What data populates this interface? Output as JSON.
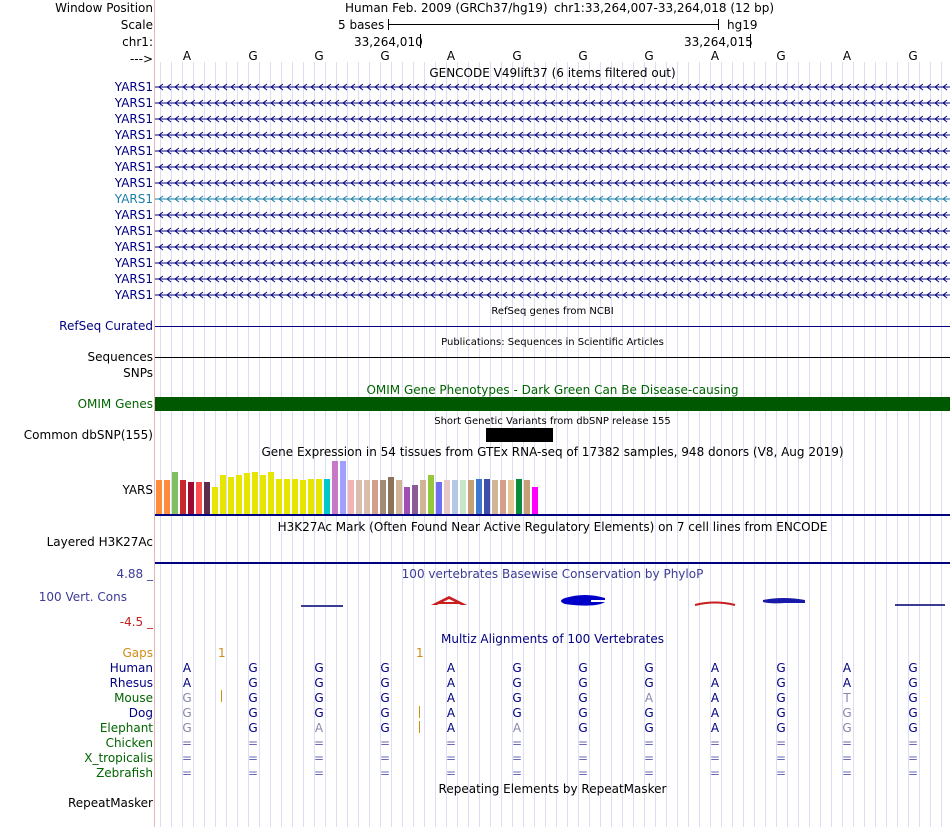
{
  "colors": {
    "navy": "#000080",
    "omim_green": "#005800",
    "omim_text": "#006400",
    "cons_blue": "#3c3c96",
    "cons_red": "#c81e1e",
    "gap_orange": "#d28c14",
    "dbsnp_black": "#000000",
    "cyan_gene": "#1a7fa8"
  },
  "header": {
    "window_position_label": "Window Position",
    "scale_label": "Scale",
    "chrom_label": "chr1:",
    "strand_label": "--->",
    "assembly": "Human Feb. 2009 (GRCh37/hg19)",
    "position": "chr1:33,264,007-33,264,018 (12 bp)",
    "scale_text": "5 bases",
    "db": "hg19",
    "tick1": "33,264,010",
    "tick2": "33,264,015"
  },
  "bases": [
    "A",
    "G",
    "G",
    "G",
    "A",
    "G",
    "G",
    "G",
    "A",
    "G",
    "A",
    "G"
  ],
  "gencode": {
    "title": "GENCODE V49lift37 (6 items filtered out)",
    "genes": [
      "YARS1",
      "YARS1",
      "YARS1",
      "YARS1",
      "YARS1",
      "YARS1",
      "YARS1",
      "YARS1",
      "YARS1",
      "YARS1",
      "YARS1",
      "YARS1",
      "YARS1",
      "YARS1"
    ],
    "highlight_index": 7
  },
  "tracks": {
    "refseq_label": "RefSeq Curated",
    "refseq_title": "RefSeq genes from NCBI",
    "sequences_label": "Sequences",
    "sequences_title": "Publications: Sequences in Scientific Articles",
    "snps_label": "SNPs",
    "omim_title": "OMIM Gene Phenotypes - Dark Green Can Be Disease-causing",
    "omim_label": "OMIM Genes",
    "dbsnp_title": "Short Genetic Variants from dbSNP release 155",
    "dbsnp_label": "Common dbSNP(155)",
    "gtex_title": "Gene Expression in 54 tissues from GTEx RNA-seq of 17382 samples, 948 donors (V8, Aug 2019)",
    "gtex_label": "YARS",
    "h3k_title": "H3K27Ac Mark (Often Found Near Active Regulatory Elements) on 7 cell lines from ENCODE",
    "h3k_label": "Layered H3K27Ac",
    "cons_title": "100 vertebrates Basewise Conservation by PhyloP",
    "cons_label": "100 Vert. Cons",
    "cons_max": "4.88 _",
    "cons_min": "-4.5 _",
    "multiz_title": "Multiz Alignments of 100 Vertebrates",
    "repeat_title": "Repeating Elements by RepeatMasker",
    "repeat_label": "RepeatMasker"
  },
  "gtex_bars": [
    {
      "color": "#ff8c3c",
      "h": 0.63
    },
    {
      "color": "#ff8c3c",
      "h": 0.63
    },
    {
      "color": "#7fbf5f",
      "h": 0.78
    },
    {
      "color": "#c8282d",
      "h": 0.63
    },
    {
      "color": "#a00a32",
      "h": 0.6
    },
    {
      "color": "#ff5050",
      "h": 0.6
    },
    {
      "color": "#5c2d4b",
      "h": 0.6
    },
    {
      "color": "#e6e600",
      "h": 0.5
    },
    {
      "color": "#e6e600",
      "h": 0.73
    },
    {
      "color": "#e6e600",
      "h": 0.68
    },
    {
      "color": "#e6e600",
      "h": 0.72
    },
    {
      "color": "#e6e600",
      "h": 0.75
    },
    {
      "color": "#e6e600",
      "h": 0.78
    },
    {
      "color": "#e6e600",
      "h": 0.73
    },
    {
      "color": "#e6e600",
      "h": 0.78
    },
    {
      "color": "#e6e600",
      "h": 0.65
    },
    {
      "color": "#e6e600",
      "h": 0.65
    },
    {
      "color": "#e6e600",
      "h": 0.65
    },
    {
      "color": "#e6e600",
      "h": 0.63
    },
    {
      "color": "#e6e600",
      "h": 0.65
    },
    {
      "color": "#e6e600",
      "h": 0.65
    },
    {
      "color": "#00c8c8",
      "h": 0.65
    },
    {
      "color": "#c878c8",
      "h": 0.98
    },
    {
      "color": "#a0a0ff",
      "h": 0.98
    },
    {
      "color": "#f0b4b4",
      "h": 0.63
    },
    {
      "color": "#d7bead",
      "h": 0.63
    },
    {
      "color": "#d7bead",
      "h": 0.63
    },
    {
      "color": "#d2a08c",
      "h": 0.63
    },
    {
      "color": "#a08c78",
      "h": 0.63
    },
    {
      "color": "#8c735a",
      "h": 0.68
    },
    {
      "color": "#d2b496",
      "h": 0.63
    },
    {
      "color": "#a050b4",
      "h": 0.5
    },
    {
      "color": "#8c5a96",
      "h": 0.53
    },
    {
      "color": "#d2b496",
      "h": 0.63
    },
    {
      "color": "#96c83c",
      "h": 0.73
    },
    {
      "color": "#6e6ef0",
      "h": 0.6
    },
    {
      "color": "#e6c8c8",
      "h": 0.63
    },
    {
      "color": "#b4c8e6",
      "h": 0.63
    },
    {
      "color": "#c8e6c8",
      "h": 0.63
    },
    {
      "color": "#c8a078",
      "h": 0.63
    },
    {
      "color": "#3c78d2",
      "h": 0.65
    },
    {
      "color": "#3c50aa",
      "h": 0.65
    },
    {
      "color": "#d2b496",
      "h": 0.63
    },
    {
      "color": "#d2a08c",
      "h": 0.63
    },
    {
      "color": "#e6c896",
      "h": 0.63
    },
    {
      "color": "#0a8c3c",
      "h": 0.65
    },
    {
      "color": "#c8a078",
      "h": 0.63
    },
    {
      "color": "#ff00ff",
      "h": 0.5
    }
  ],
  "multiz": {
    "gaps_label": "Gaps",
    "gap_marks": [
      "1",
      "1"
    ],
    "species": [
      {
        "name": "Human",
        "color": "#000080",
        "bases": [
          "A",
          "G",
          "G",
          "G",
          "A",
          "G",
          "G",
          "G",
          "A",
          "G",
          "A",
          "G"
        ]
      },
      {
        "name": "Rhesus",
        "color": "#000080",
        "bases": [
          "A",
          "G",
          "G",
          "G",
          "A",
          "G",
          "G",
          "G",
          "A",
          "G",
          "A",
          "G"
        ]
      },
      {
        "name": "Mouse",
        "color": "#006400",
        "bases": [
          "G",
          "G",
          "G",
          "G",
          "A",
          "G",
          "G",
          "A",
          "A",
          "G",
          "T",
          "G"
        ]
      },
      {
        "name": "Dog",
        "color": "#000080",
        "bases": [
          "G",
          "G",
          "G",
          "G",
          "A",
          "G",
          "G",
          "G",
          "A",
          "G",
          "G",
          "G"
        ]
      },
      {
        "name": "Elephant",
        "color": "#006400",
        "bases": [
          "G",
          "G",
          "A",
          "G",
          "A",
          "A",
          "G",
          "G",
          "A",
          "G",
          "G",
          "G"
        ]
      },
      {
        "name": "Chicken",
        "color": "#006400",
        "bases": [
          "=",
          "=",
          "=",
          "=",
          "=",
          "=",
          "=",
          "=",
          "=",
          "=",
          "=",
          "="
        ]
      },
      {
        "name": "X_tropicalis",
        "color": "#006400",
        "bases": [
          "=",
          "=",
          "=",
          "=",
          "=",
          "=",
          "=",
          "=",
          "=",
          "=",
          "=",
          "="
        ]
      },
      {
        "name": "Zebrafish",
        "color": "#006400",
        "bases": [
          "=",
          "=",
          "=",
          "=",
          "=",
          "=",
          "=",
          "=",
          "=",
          "=",
          "=",
          "="
        ]
      }
    ]
  }
}
